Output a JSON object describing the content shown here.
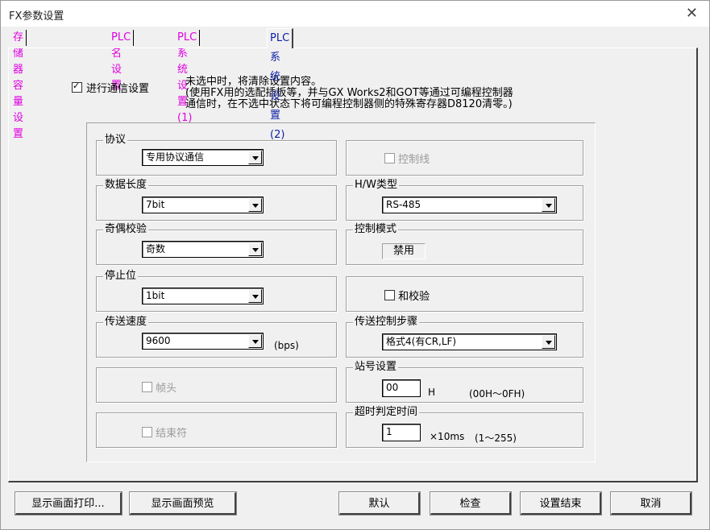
{
  "window": {
    "title": "FX参数设置",
    "close": "✕"
  },
  "tabs": [
    {
      "label": "存储器容量设置"
    },
    {
      "label": "PLC名设置"
    },
    {
      "label": "PLC系统设置(1)"
    },
    {
      "label": "PLC系统设置(2)"
    }
  ],
  "comm_setting": {
    "label": "进行通信设置",
    "checked": true,
    "note": [
      "未选中时，将清除设置内容。",
      "(使用FX用的选配插板等，并与GX Works2和GOT等通过可编程控制器",
      "通信时，在不选中状态下将可编程控制器侧的特殊寄存器D8120清零。)"
    ]
  },
  "protocol": {
    "label": "协议",
    "value": "专用协议通信"
  },
  "data_length": {
    "label": "数据长度",
    "value": "7bit"
  },
  "parity": {
    "label": "奇偶校验",
    "value": "奇数"
  },
  "stop_bit": {
    "label": "停止位",
    "value": "1bit"
  },
  "baud_rate": {
    "label": "传送速度",
    "value": "9600",
    "unit": "(bps)"
  },
  "header": {
    "label": "帧头"
  },
  "terminator": {
    "label": "结束符"
  },
  "control_line": {
    "label": "控制线"
  },
  "hw_type": {
    "label": "H/W类型",
    "value": "RS-485"
  },
  "control_mode": {
    "label": "控制模式",
    "value": "禁用"
  },
  "checksum": {
    "label": "和校验"
  },
  "transmission_control": {
    "label": "传送控制步骤",
    "value": "格式4(有CR,LF)"
  },
  "station_number": {
    "label": "站号设置",
    "value": "00",
    "unit": "H",
    "range": "(00H～0FH)"
  },
  "timeout": {
    "label": "超时判定时间",
    "value": "1",
    "unit": "×10ms",
    "range": "(1～255)"
  },
  "buttons": {
    "print": "显示画面打印...",
    "preview": "显示画面预览",
    "default": "默认",
    "check": "检查",
    "finish": "设置结束",
    "cancel": "取消"
  }
}
